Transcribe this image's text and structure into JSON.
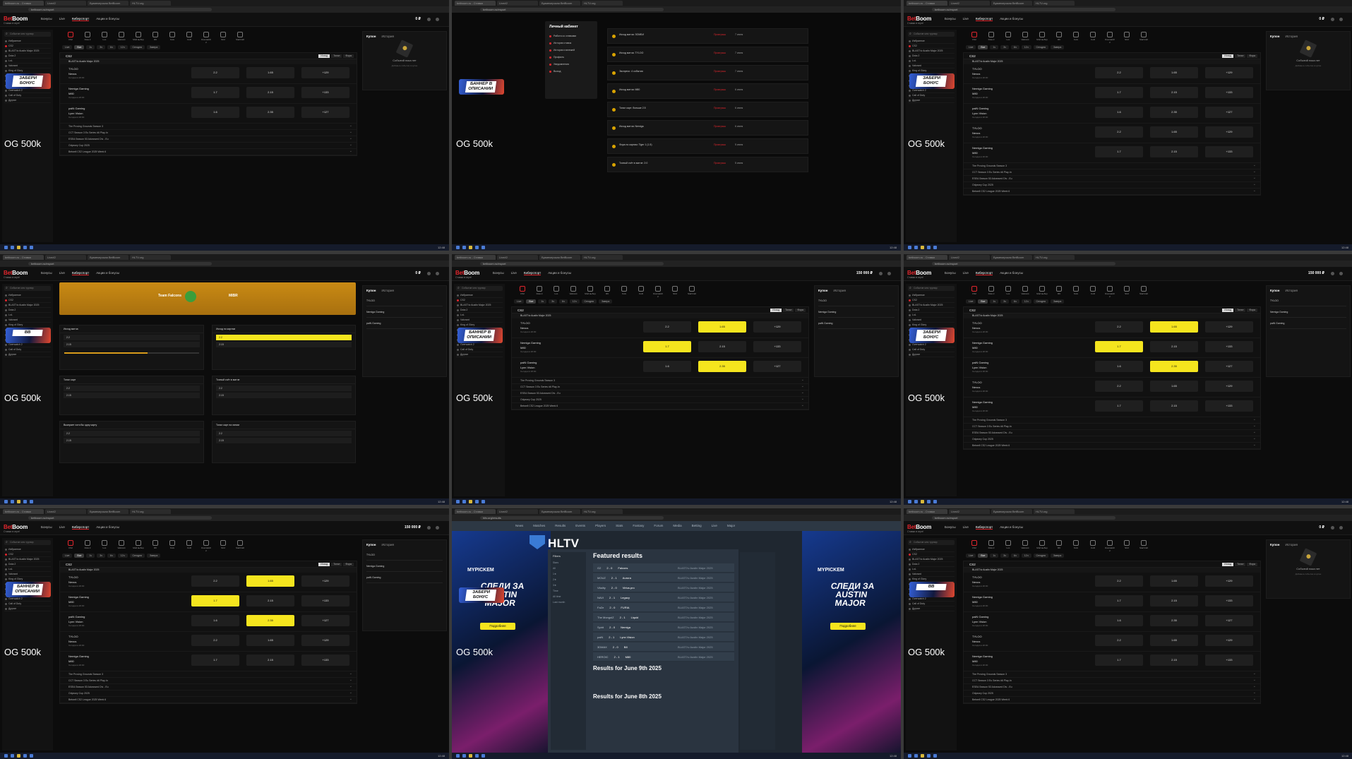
{
  "site": {
    "logo_main": "Boom",
    "logo_prefix": "Bet",
    "logo_sub": "Ставки в игре!",
    "nav": [
      "Бонусы",
      "Live",
      "Киберспорт",
      "Акции и бонусы"
    ],
    "balance_small": "0 ₽",
    "balance_big": "150 000 ₽"
  },
  "browser": {
    "url_betboom": "betboom.ru/esport",
    "url_hltv": "hltv.org/results",
    "tabs": [
      "betboom.ru - Ставки",
      "Live#2",
      "Букмекерская BetBoom",
      "HLTV.org"
    ],
    "clock": "12:48"
  },
  "stream_overlay": "OG 500k",
  "sidebar": {
    "search_placeholder": "Событие или турнир",
    "items": [
      "Избранное",
      "CS2",
      "BLAST.tv Austin Major 2025",
      "Dota 2",
      "LoL",
      "Valorant",
      "King of Glory",
      "Rainbow Six",
      "Mobile Legends",
      "StarCraft",
      "Overwatch 2",
      "Call of Duty",
      "Другие"
    ]
  },
  "banners": {
    "bonus": "ЗАБЕРИ БОНУС",
    "description": "БАННЕР В ОПИСАНИИ",
    "short": "BB"
  },
  "sports": [
    "CS2",
    "Dota 2",
    "LoL",
    "Valorant",
    "Мой выбор",
    "R6",
    "KoG",
    "CoD",
    "Overwatch 2",
    "SC2",
    "StarCraft"
  ],
  "filters": [
    "Live",
    "Все",
    "1ч",
    "3ч",
    "6ч",
    "12ч",
    "Сегодня",
    "Завтра"
  ],
  "panel": {
    "title": "CS2",
    "tabs": [
      "Исход",
      "Тотал",
      "Фора"
    ],
    "league": "BLAST.tv Austin Major 2025",
    "matches": [
      {
        "team1": "TYLOO",
        "team2": "Nexus",
        "meta": "Сегодня в 20:00",
        "odds": [
          "2.2",
          "1.65",
          "+129"
        ]
      },
      {
        "team1": "Nemiga Gaming",
        "team2": "M80",
        "meta": "Сегодня в 20:00",
        "odds": [
          "1.7",
          "2.15",
          "+133"
        ]
      },
      {
        "team1": "paiN Gaming",
        "team2": "Lynn Vision",
        "meta": "Сегодня в 20:00",
        "odds": [
          "1.6",
          "2.35",
          "+127"
        ]
      }
    ],
    "collapsed": [
      "The Proving Grounds Season 3",
      "CCT Season 3 Eu Series #6 Play-In",
      "ESEA Season 53 Advanced Div - Eu",
      "Odyssey Cup 2025",
      "Betwell CS2 League 2025 Week 6"
    ]
  },
  "coupon": {
    "title": "Купон",
    "history": "История",
    "empty": "Событий пока нет",
    "empty_sub": "Добавьте событие в купон"
  },
  "cabinet": {
    "title": "Личный кабинет",
    "items": [
      "Работа со ставками",
      "История ставок",
      "История платежей",
      "Профиль",
      "Уведомления",
      "Выход"
    ],
    "history_rows": [
      {
        "title": "Исход матча: ЗОМБИ",
        "value": "Проигрыш",
        "date": "7 июня"
      },
      {
        "title": "Исход матча: TYLOO",
        "value": "Проигрыш",
        "date": "7 июня"
      },
      {
        "title": "Экспресс: 4 события",
        "value": "Проигрыш",
        "date": "7 июня"
      },
      {
        "title": "Исход матча: M80",
        "value": "Проигрыш",
        "date": "6 июня"
      },
      {
        "title": "Тотал карт: больше 2.5",
        "value": "Проигрыш",
        "date": "6 июня"
      },
      {
        "title": "Исход матча: Nemiga",
        "value": "Проигрыш",
        "date": "6 июня"
      },
      {
        "title": "Фора по картам: Tiger 1 (1.5)",
        "value": "Проигрыш",
        "date": "5 июня"
      },
      {
        "title": "Точный счёт в матче: 2:0",
        "value": "Проигрыш",
        "date": "5 июня"
      }
    ]
  },
  "match_page": {
    "team1": "Team Falcons",
    "team2": "MIBR",
    "markets": [
      "Исход матча",
      "Исход по картам",
      "Тотал карт",
      "Точный счёт в матче",
      "Выиграет хотя бы одну карту",
      "Тотал карт на линии"
    ]
  },
  "hltv": {
    "nav": [
      "News",
      "Matches",
      "Results",
      "Events",
      "Players",
      "Stats",
      "Fantasy",
      "Forum",
      "Media",
      "Betting",
      "Live",
      "Major"
    ],
    "logo": "HLTV",
    "ad_brand": "MYPICKEM",
    "ad_text": "СЛЕДИ ЗА AUSTIN MAJOR",
    "ad_button": "Подробнее",
    "featured": "Featured results",
    "left_header": "Filters",
    "left_items": [
      "Stars",
      "All",
      "1★",
      "2★",
      "3★",
      "Time",
      "All time",
      "Last month"
    ],
    "results": [
      {
        "t1": "G2",
        "score": "2 - 0",
        "t2": "Falcons",
        "event": "BLAST.tv Austin Major 2025"
      },
      {
        "t1": "MOUZ",
        "score": "2 - 1",
        "t2": "Aurora",
        "event": "BLAST.tv Austin Major 2025"
      },
      {
        "t1": "Vitality",
        "score": "2 - 0",
        "t2": "Virtus.pro",
        "event": "BLAST.tv Austin Major 2025"
      },
      {
        "t1": "NAVI",
        "score": "2 - 1",
        "t2": "Legacy",
        "event": "BLAST.tv Austin Major 2025"
      },
      {
        "t1": "FaZe",
        "score": "2 - 0",
        "t2": "FURIA",
        "event": "BLAST.tv Austin Major 2025"
      },
      {
        "t1": "The MongolZ",
        "score": "2 - 1",
        "t2": "Liquid",
        "event": "BLAST.tv Austin Major 2025"
      },
      {
        "t1": "Spirit",
        "score": "2 - 0",
        "t2": "Nemiga",
        "event": "BLAST.tv Austin Major 2025"
      },
      {
        "t1": "paiN",
        "score": "2 - 1",
        "t2": "Lynn Vision",
        "event": "BLAST.tv Austin Major 2025"
      },
      {
        "t1": "3DMAX",
        "score": "2 - 0",
        "t2": "B8",
        "event": "BLAST.tv Austin Major 2025"
      },
      {
        "t1": "HEROIC",
        "score": "2 - 1",
        "t2": "M80",
        "event": "BLAST.tv Austin Major 2025"
      }
    ],
    "results_h1": "Results for June 9th 2025",
    "results_h2": "Results for June 8th 2025"
  },
  "colors": {
    "brand_red": "#e1262d",
    "selected_yellow": "#f5e51e",
    "background": "#0c0c0c"
  }
}
